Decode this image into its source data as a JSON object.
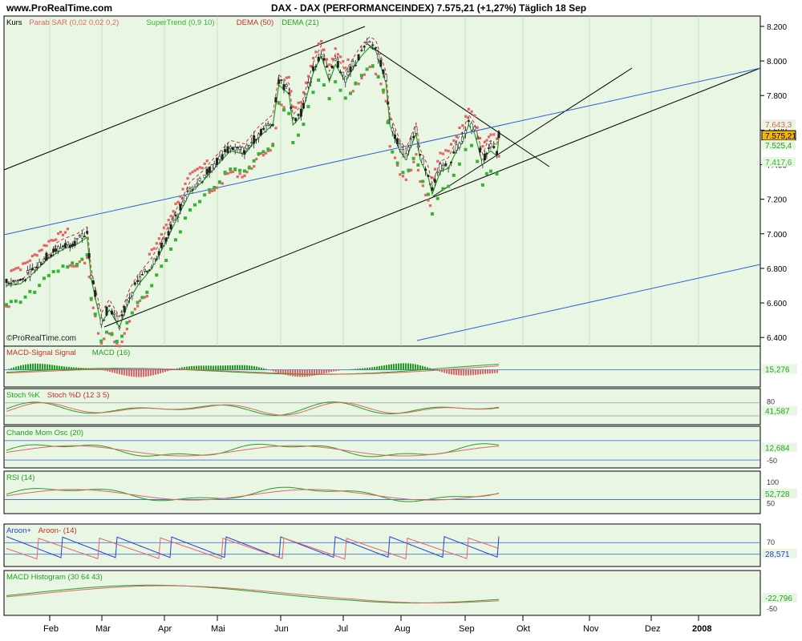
{
  "header": {
    "site": "www.ProRealTime.com",
    "title": "DAX - DAX (PERFORMANCEINDEX)   7.575,21 (+1,27%)   Täglich  18 Sep"
  },
  "colors": {
    "panel_bg": "#e9f6e3",
    "sar": "#e36464",
    "supertrend": "#33b533",
    "dema50": "#c43030",
    "dema21": "#22a022",
    "channel": "#000000",
    "blue_channel": "#2e5ed8",
    "candle": "#222222",
    "last_price_bg": "#f5b800"
  },
  "chart_data": [
    {
      "type": "candlestick",
      "panel": "price",
      "legend": [
        {
          "label": "Kurs",
          "color": "#000000"
        },
        {
          "label": "Parab SAR (0,02 0,02 0,2)",
          "color": "#e36464"
        },
        {
          "label": "SuperTrend (0,9 10)",
          "color": "#33b533"
        },
        {
          "label": "DEMA (50)",
          "color": "#c43030"
        },
        {
          "label": "DEMA (21)",
          "color": "#22a022"
        }
      ],
      "x_labels": [
        "Feb",
        "Mär",
        "Apr",
        "Mai",
        "Jun",
        "Jul",
        "Aug",
        "Sep",
        "Okt",
        "Nov",
        "Dez",
        "2008"
      ],
      "y_ticks": [
        "8.200",
        "8.000",
        "7.800",
        "7.600",
        "7.400",
        "7.200",
        "7.000",
        "6.800",
        "6.600",
        "6.400"
      ],
      "ylim": [
        6350,
        8260
      ],
      "close_points": [
        [
          "Jan 17",
          6720
        ],
        [
          "Jan 24",
          6730
        ],
        [
          "Jan 31",
          6800
        ],
        [
          "Feb 07",
          6880
        ],
        [
          "Feb 14",
          6930
        ],
        [
          "Feb 21",
          6960
        ],
        [
          "Feb 26",
          7000
        ],
        [
          "Feb 28",
          6760
        ],
        [
          "Mar 02",
          6650
        ],
        [
          "Mar 05",
          6500
        ],
        [
          "Mar 09",
          6580
        ],
        [
          "Mar 14",
          6480
        ],
        [
          "Mar 19",
          6640
        ],
        [
          "Mar 23",
          6720
        ],
        [
          "Mar 30",
          6820
        ],
        [
          "Apr 05",
          6950
        ],
        [
          "Apr 12",
          7120
        ],
        [
          "Apr 18",
          7260
        ],
        [
          "Apr 24",
          7320
        ],
        [
          "Apr 30",
          7400
        ],
        [
          "May 08",
          7500
        ],
        [
          "May 15",
          7480
        ],
        [
          "May 22",
          7580
        ],
        [
          "May 29",
          7650
        ],
        [
          "Jun 01",
          7880
        ],
        [
          "Jun 06",
          7830
        ],
        [
          "Jun 08",
          7650
        ],
        [
          "Jun 12",
          7700
        ],
        [
          "Jun 18",
          7950
        ],
        [
          "Jun 22",
          8050
        ],
        [
          "Jun 26",
          7900
        ],
        [
          "Jun 29",
          8000
        ],
        [
          "Jul 04",
          7900
        ],
        [
          "Jul 09",
          8000
        ],
        [
          "Jul 12",
          8050
        ],
        [
          "Jul 16",
          8100
        ],
        [
          "Jul 19",
          8080
        ],
        [
          "Jul 24",
          7900
        ],
        [
          "Jul 26",
          7650
        ],
        [
          "Jul 31",
          7500
        ],
        [
          "Aug 03",
          7450
        ],
        [
          "Aug 08",
          7600
        ],
        [
          "Aug 10",
          7450
        ],
        [
          "Aug 14",
          7350
        ],
        [
          "Aug 16",
          7250
        ],
        [
          "Aug 20",
          7380
        ],
        [
          "Aug 24",
          7400
        ],
        [
          "Aug 28",
          7500
        ],
        [
          "Aug 31",
          7550
        ],
        [
          "Sep 03",
          7650
        ],
        [
          "Sep 06",
          7600
        ],
        [
          "Sep 10",
          7420
        ],
        [
          "Sep 12",
          7480
        ],
        [
          "Sep 14",
          7500
        ],
        [
          "Sep 17",
          7470
        ],
        [
          "Sep 18",
          7575
        ]
      ],
      "right_labels": [
        "7.643,3",
        "7.575,21",
        "7.525,4",
        "7.417,6"
      ],
      "watermark": "©ProRealTime.com"
    },
    {
      "type": "line",
      "panel": "macd",
      "legend": [
        {
          "label": "MACD-Signal Signal",
          "color": "#c43030"
        },
        {
          "label": "MACD (16)",
          "color": "#22a022"
        }
      ],
      "right_label": "15,276"
    },
    {
      "type": "line",
      "panel": "stoch",
      "legend": [
        {
          "label": "Stoch %K",
          "color": "#22a022"
        },
        {
          "label": "Stoch %D (12 3 5)",
          "color": "#c43030"
        }
      ],
      "right_label": "41,587",
      "levels": [
        "80",
        "20"
      ]
    },
    {
      "type": "line",
      "panel": "cmo",
      "legend": [
        {
          "label": "Chande Mom Osc (20)",
          "color": "#22a022"
        }
      ],
      "right_label": "12,684",
      "levels": [
        "50",
        "-50"
      ]
    },
    {
      "type": "line",
      "panel": "rsi",
      "legend": [
        {
          "label": "RSI (14)",
          "color": "#22a022"
        }
      ],
      "right_label": "52,728",
      "levels": [
        "100",
        "50"
      ]
    },
    {
      "type": "line",
      "panel": "aroon",
      "legend": [
        {
          "label": "Aroon+",
          "color": "#2244cc"
        },
        {
          "label": "Aroon- (14)",
          "color": "#c43030"
        }
      ],
      "right_label": "28,571",
      "levels": [
        "100",
        "70",
        "30"
      ]
    },
    {
      "type": "line",
      "panel": "macd_hist",
      "legend": [
        {
          "label": "MACD Histogram (30 64 43)",
          "color": "#22a022"
        }
      ],
      "right_label": "-22,796",
      "levels": [
        "-50"
      ]
    }
  ]
}
